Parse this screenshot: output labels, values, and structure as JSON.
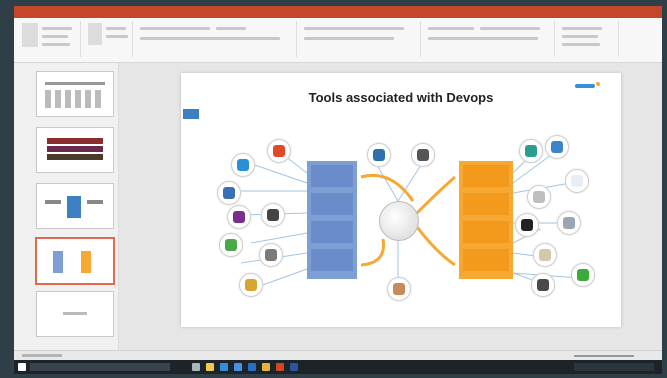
{
  "slide": {
    "title": "Tools associated with Devops"
  },
  "colors": {
    "titlebar": "#c4472a",
    "dev_stage": "#7d9fd4",
    "ops_stage": "#f7a833",
    "taskbar": "#1c2329"
  },
  "icons": [
    "powerpoint-icon",
    "save-icon",
    "undo-icon",
    "redo-icon",
    "start-icon",
    "search-icon",
    "taskview-icon",
    "explorer-icon",
    "edge-icon",
    "store-icon",
    "mail-icon",
    "chrome-icon",
    "powerpoint-taskbar-icon",
    "word-icon"
  ]
}
